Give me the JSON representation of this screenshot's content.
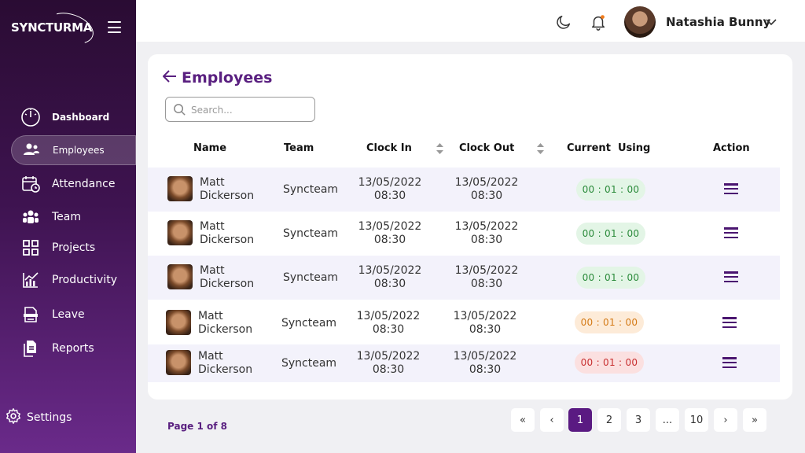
{
  "brand": {
    "name": "SYNCTURMA"
  },
  "sidebar": {
    "items": [
      {
        "label": "Dashboard",
        "icon": "dashboard-gauge-icon"
      },
      {
        "label": "Employees",
        "icon": "employees-group-icon",
        "active": true
      },
      {
        "label": "Attendance",
        "icon": "calendar-clock-icon"
      },
      {
        "label": "Team",
        "icon": "team-icon"
      },
      {
        "label": "Projects",
        "icon": "grid-icon"
      },
      {
        "label": "Productivity",
        "icon": "chart-up-icon"
      },
      {
        "label": "Leave",
        "icon": "leave-icon"
      },
      {
        "label": "Reports",
        "icon": "reports-icon"
      }
    ],
    "settings_label": "Settings"
  },
  "header": {
    "user_name": "Natashia Bunny"
  },
  "page": {
    "title": "Employees",
    "search_placeholder": "Search..."
  },
  "table": {
    "columns": [
      "Name",
      "Team",
      "Clock In",
      "Clock Out",
      "Current  Using",
      "Action"
    ],
    "rows": [
      {
        "name_first": "Matt",
        "name_last": "Dickerson",
        "team": "Syncteam",
        "clock_in_date": "13/05/2022",
        "clock_in_time": "08:30",
        "clock_out_date": "13/05/2022",
        "clock_out_time": "08:30",
        "current_using": "00 : 01 : 00",
        "status_color": "green"
      },
      {
        "name_first": "Matt",
        "name_last": "Dickerson",
        "team": "Syncteam",
        "clock_in_date": "13/05/2022",
        "clock_in_time": "08:30",
        "clock_out_date": "13/05/2022",
        "clock_out_time": "08:30",
        "current_using": "00 : 01 : 00",
        "status_color": "green"
      },
      {
        "name_first": "Matt",
        "name_last": "Dickerson",
        "team": "Syncteam",
        "clock_in_date": "13/05/2022",
        "clock_in_time": "08:30",
        "clock_out_date": "13/05/2022",
        "clock_out_time": "08:30",
        "current_using": "00 : 01 : 00",
        "status_color": "green"
      },
      {
        "name_first": "Matt",
        "name_last": "Dickerson",
        "team": "Syncteam",
        "clock_in_date": "13/05/2022",
        "clock_in_time": "08:30",
        "clock_out_date": "13/05/2022",
        "clock_out_time": "08:30",
        "current_using": "00 : 01 : 00",
        "status_color": "orange"
      },
      {
        "name_first": "Matt",
        "name_last": "Dickerson",
        "team": "Syncteam",
        "clock_in_date": "13/05/2022",
        "clock_in_time": "08:30",
        "clock_out_date": "13/05/2022",
        "clock_out_time": "08:30",
        "current_using": "00 : 01 : 00",
        "status_color": "red"
      }
    ]
  },
  "pagination": {
    "info": "Page 1 of 8",
    "first": "«",
    "prev": "‹",
    "pages": [
      "1",
      "2",
      "3",
      "...",
      "10"
    ],
    "current": "1",
    "next": "›",
    "last": "»"
  },
  "colors": {
    "accent": "#5a1a82",
    "sidebar_top": "#2a0c33",
    "sidebar_bottom": "#6a2a8a"
  }
}
